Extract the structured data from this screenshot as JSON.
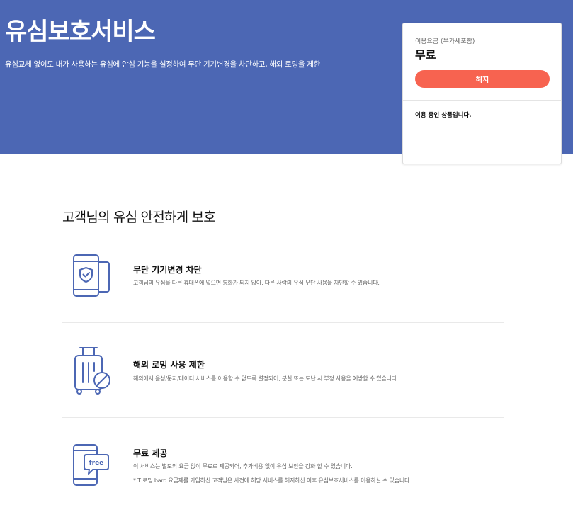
{
  "hero": {
    "title": "유심보호서비스",
    "description": "유심교체 없이도 내가 사용하는 유심에 안심 기능을 설정하여 무단 기기변경을 차단하고, 해외 로밍을 제한"
  },
  "price_card": {
    "label": "이용요금 (부가세포함)",
    "value": "무료",
    "cancel_label": "해지",
    "status": "이용 중인 상품입니다."
  },
  "section": {
    "title": "고객님의 유심 안전하게 보호"
  },
  "features": [
    {
      "icon": "phone-shield-icon",
      "title": "무단 기기변경 차단",
      "description": "고객님의 유심을 다른 휴대폰에 넣으면 통화가 되지 않아, 다른 사람의 유심 무단 사용을 차단할 수 있습니다."
    },
    {
      "icon": "luggage-block-icon",
      "title": "해외 로밍 사용 제한",
      "description": "해외에서 음성/문자/데이터 서비스를 이용할 수 없도록 설정되어, 분실 또는 도난 시 부정 사용을 예방할 수 있습니다."
    },
    {
      "icon": "phone-free-icon",
      "title": "무료 제공",
      "description": "이 서비스는 별도의 요금 없이 무료로 제공되어, 추가비용 없이 유심 보안을 강화 할 수 있습니다.",
      "note": "* T 로밍 baro 요금제를 가입하신 고객님은 사전에 해당 서비스를 해지하신 이후 유심보호서비스를 이용하실 수 있습니다.",
      "badge": "free"
    }
  ],
  "colors": {
    "hero_bg": "#4c67b4",
    "cancel_button": "#f76350",
    "icon_stroke": "#4c67b4"
  }
}
